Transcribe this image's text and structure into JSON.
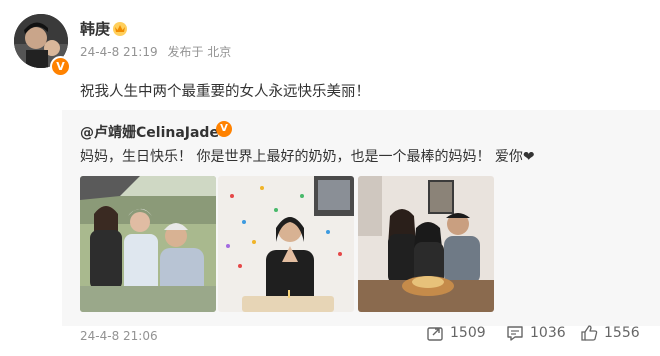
{
  "author": {
    "name": "韩庚",
    "verified_mark": "V"
  },
  "meta": {
    "time": "24-4-8 21:19",
    "location": "发布于 北京"
  },
  "post": {
    "text": "祝我人生中两个最重要的女人永远快乐美丽！"
  },
  "repost": {
    "author": "@卢靖姗CelinaJade",
    "verified_mark": "V",
    "text": "妈妈，生日快乐！ 你是世界上最好的奶奶，也是一个最棒的妈妈！ 爱你❤",
    "time": "24-4-8 21:06",
    "actions": {
      "share_count": "1509",
      "comment_count": "1036",
      "like_count": "1556"
    }
  },
  "icons": {
    "share": "share-icon",
    "comment": "comment-icon",
    "like": "thumbs-up-icon",
    "crown": "crown-badge-icon"
  },
  "colors": {
    "accent": "#ff8200",
    "muted": "#939393",
    "repost_bg": "#f7f7f7"
  }
}
